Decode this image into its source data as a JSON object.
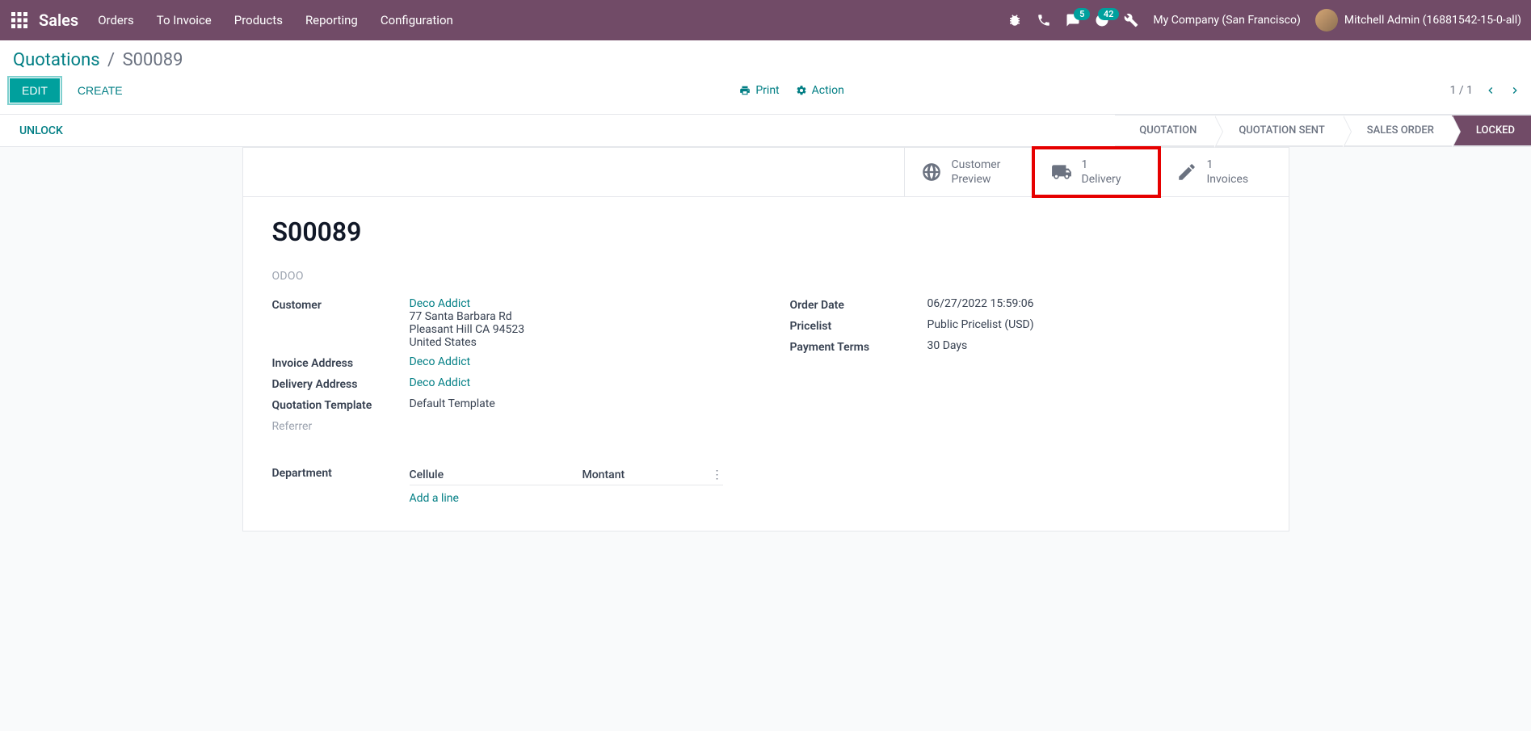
{
  "topnav": {
    "brand": "Sales",
    "menu": [
      "Orders",
      "To Invoice",
      "Products",
      "Reporting",
      "Configuration"
    ],
    "msg_badge": "5",
    "activity_badge": "42",
    "company": "My Company (San Francisco)",
    "user": "Mitchell Admin (16881542-15-0-all)"
  },
  "breadcrumb": {
    "root": "Quotations",
    "current": "S00089"
  },
  "actions": {
    "edit": "EDIT",
    "create": "CREATE",
    "print": "Print",
    "action": "Action",
    "pager": "1 / 1"
  },
  "statusbar": {
    "unlock": "UNLOCK",
    "stages": [
      "QUOTATION",
      "QUOTATION SENT",
      "SALES ORDER",
      "LOCKED"
    ]
  },
  "stats": {
    "preview": {
      "line1": "Customer",
      "line2": "Preview"
    },
    "delivery": {
      "count": "1",
      "label": "Delivery"
    },
    "invoices": {
      "count": "1",
      "label": "Invoices"
    }
  },
  "record": {
    "name": "S00089",
    "tag": "ODOO",
    "left": {
      "customer_label": "Customer",
      "customer_name": "Deco Addict",
      "addr1": "77 Santa Barbara Rd",
      "addr2": "Pleasant Hill CA 94523",
      "addr3": "United States",
      "invoice_label": "Invoice Address",
      "invoice_value": "Deco Addict",
      "delivery_label": "Delivery Address",
      "delivery_value": "Deco Addict",
      "template_label": "Quotation Template",
      "template_value": "Default Template",
      "referrer_label": "Referrer"
    },
    "right": {
      "order_date_label": "Order Date",
      "order_date_value": "06/27/2022 15:59:06",
      "pricelist_label": "Pricelist",
      "pricelist_value": "Public Pricelist (USD)",
      "payment_label": "Payment Terms",
      "payment_value": "30 Days"
    }
  },
  "dept": {
    "label": "Department",
    "col1": "Cellule",
    "col2": "Montant",
    "add": "Add a line"
  }
}
